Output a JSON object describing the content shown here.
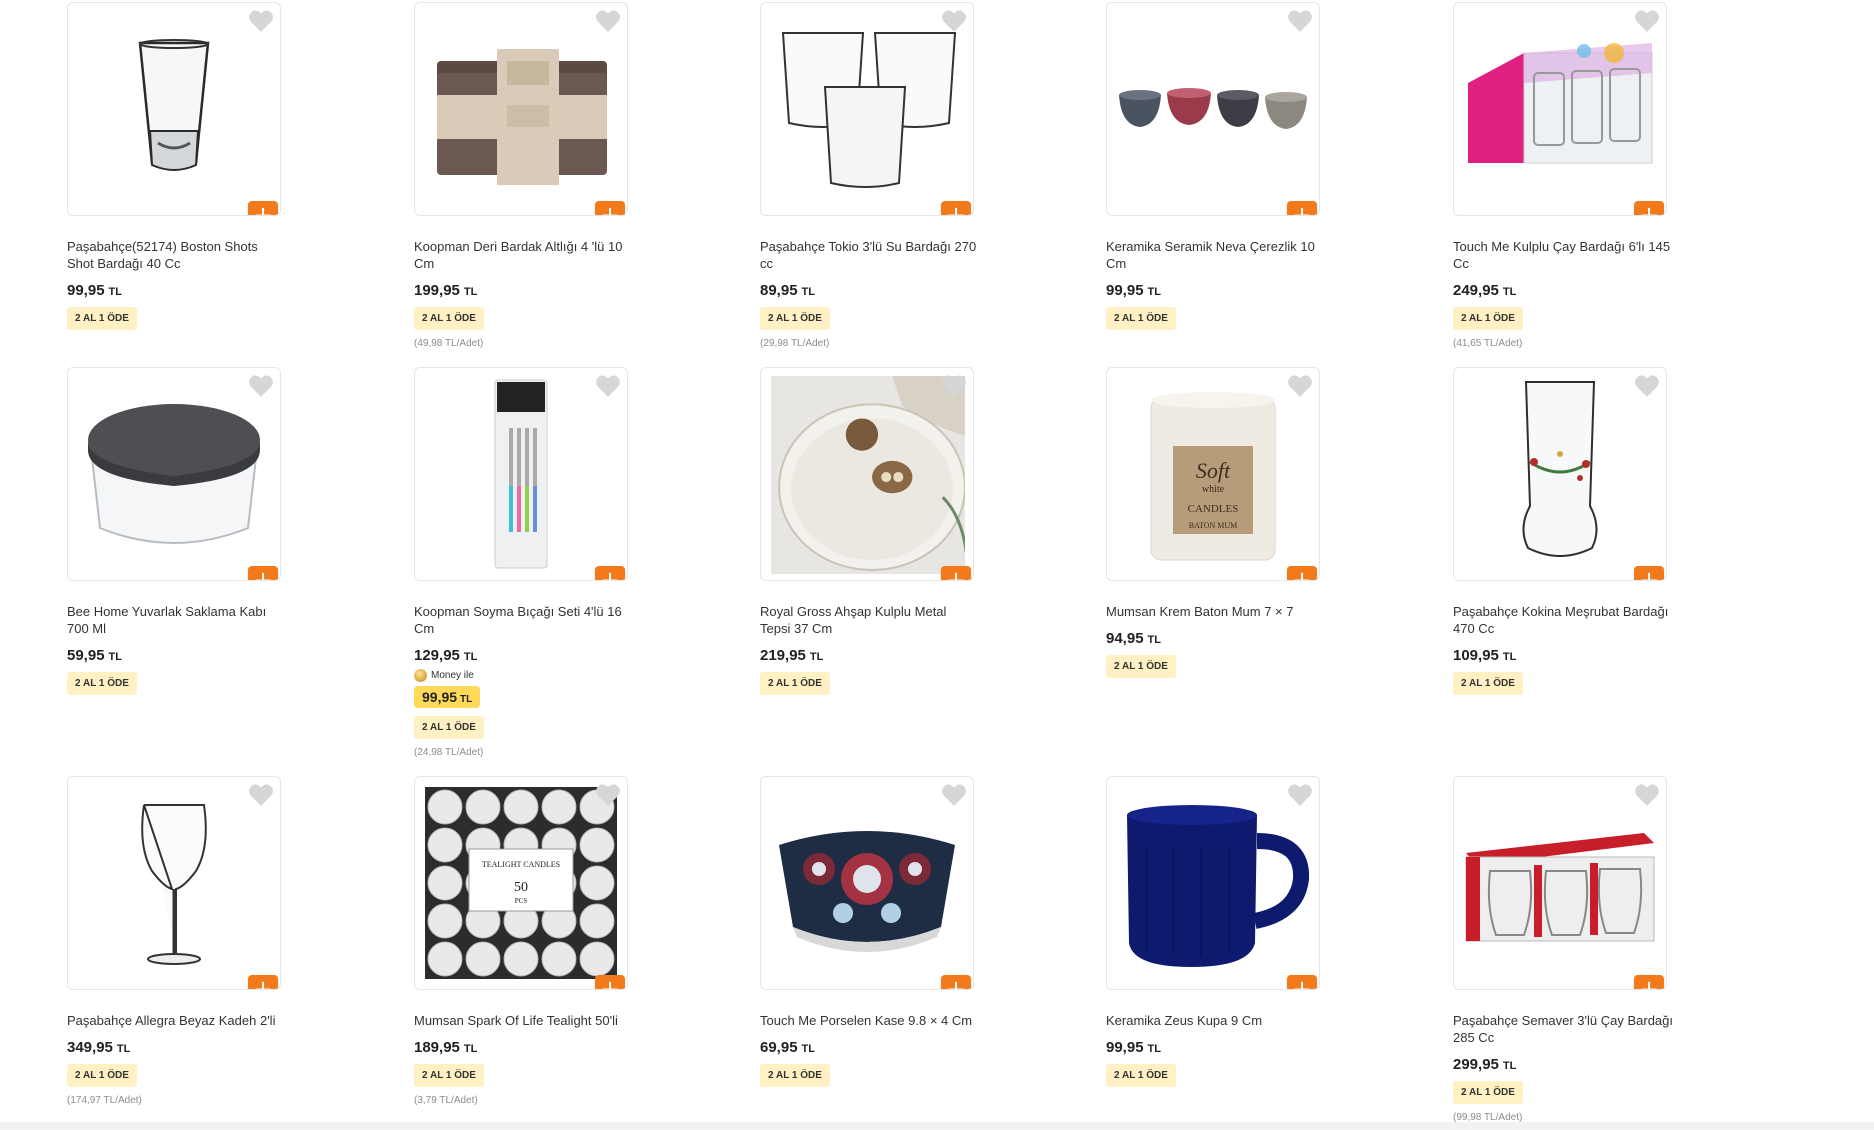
{
  "accent_color": "#f27a1a",
  "badge_color": "#fff1c4",
  "products": [
    {
      "title": "Paşabahçe(52174) Boston Shots Shot Bardağı 40 Cc",
      "price": "99,95",
      "currency": "TL",
      "badge": "2 AL 1 ÖDE",
      "unit": "",
      "image": "shot-glass"
    },
    {
      "title": "Koopman Deri Bardak Altlığı 4 'lü 10 Cm",
      "price": "199,95",
      "currency": "TL",
      "badge": "2 AL 1 ÖDE",
      "unit": "(49,98 TL/Adet)",
      "image": "coaster-set"
    },
    {
      "title": "Paşabahçe Tokio 3'lü Su Bardağı 270 cc",
      "price": "89,95",
      "currency": "TL",
      "badge": "2 AL 1 ÖDE",
      "unit": "(29,98 TL/Adet)",
      "image": "water-glasses"
    },
    {
      "title": "Keramika Seramik Neva Çerezlik 10 Cm",
      "price": "99,95",
      "currency": "TL",
      "badge": "2 AL 1 ÖDE",
      "unit": "",
      "image": "ceramic-bowls"
    },
    {
      "title": "Touch Me Kulplu Çay Bardağı 6'lı 145 Cc",
      "price": "249,95",
      "currency": "TL",
      "badge": "2 AL 1 ÖDE",
      "unit": "(41,65 TL/Adet)",
      "image": "tea-glass-box"
    },
    {
      "title": "Bee Home Yuvarlak Saklama Kabı 700 Ml",
      "price": "59,95",
      "currency": "TL",
      "badge": "2 AL 1 ÖDE",
      "unit": "",
      "image": "storage-container"
    },
    {
      "title": "Koopman Soyma Bıçağı Seti 4'lü 16 Cm",
      "price": "129,95",
      "currency": "TL",
      "badge": "2 AL 1 ÖDE",
      "unit": "(24,98 TL/Adet)",
      "image": "knife-set",
      "money_label": "Money ile",
      "money_price": "99,95"
    },
    {
      "title": "Royal Gross Ahşap Kulplu Metal Tepsi 37 Cm",
      "price": "219,95",
      "currency": "TL",
      "badge": "2 AL 1 ÖDE",
      "unit": "",
      "image": "metal-tray"
    },
    {
      "title": "Mumsan Krem Baton Mum 7 × 7",
      "price": "94,95",
      "currency": "TL",
      "badge": "2 AL 1 ÖDE",
      "unit": "",
      "image": "pillar-candle",
      "candle_text": [
        "Soft",
        "white",
        "CANDLES",
        "BATON MUM"
      ]
    },
    {
      "title": "Paşabahçe Kokina Meşrubat Bardağı 470 Cc",
      "price": "109,95",
      "currency": "TL",
      "badge": "2 AL 1 ÖDE",
      "unit": "",
      "image": "kokina-glass"
    },
    {
      "title": "Paşabahçe Allegra Beyaz Kadeh 2'li",
      "price": "349,95",
      "currency": "TL",
      "badge": "2 AL 1 ÖDE",
      "unit": "(174,97 TL/Adet)",
      "image": "wine-glass"
    },
    {
      "title": "Mumsan Spark Of Life Tealight 50'li",
      "price": "189,95",
      "currency": "TL",
      "badge": "2 AL 1 ÖDE",
      "unit": "(3,79 TL/Adet)",
      "image": "tealight-pack",
      "pack_text": [
        "TEALIGHT CANDLES",
        "50",
        "PCS"
      ]
    },
    {
      "title": "Touch Me Porselen Kase 9.8 × 4 Cm",
      "price": "69,95",
      "currency": "TL",
      "badge": "2 AL 1 ÖDE",
      "unit": "",
      "image": "patterned-bowl"
    },
    {
      "title": "Keramika Zeus Kupa 9 Cm",
      "price": "99,95",
      "currency": "TL",
      "badge": "2 AL 1 ÖDE",
      "unit": "",
      "image": "blue-mug"
    },
    {
      "title": "Paşabahçe Semaver 3'lü Çay Bardağı 285 Cc",
      "price": "299,95",
      "currency": "TL",
      "badge": "2 AL 1 ÖDE",
      "unit": "(99,98 TL/Adet)",
      "image": "tea-glass-pack"
    }
  ]
}
